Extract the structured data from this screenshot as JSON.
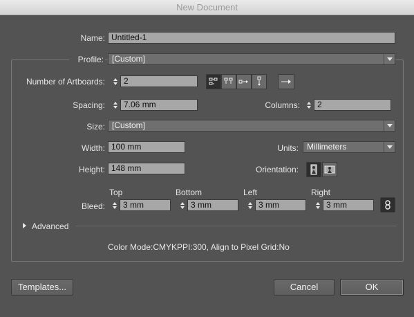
{
  "window": {
    "title": "New Document"
  },
  "name": {
    "label": "Name:",
    "value": "Untitled-1"
  },
  "profile": {
    "label": "Profile:",
    "value": "[Custom]"
  },
  "artboards": {
    "label": "Number of Artboards:",
    "value": "2",
    "layout_icons": [
      "grid-by-row-icon",
      "grid-by-column-icon",
      "arrange-by-row-icon",
      "arrange-by-column-icon"
    ],
    "direction_icon": "right-to-left-icon"
  },
  "spacing": {
    "label": "Spacing:",
    "value": "7.06 mm"
  },
  "columns": {
    "label": "Columns:",
    "value": "2"
  },
  "size": {
    "label": "Size:",
    "value": "[Custom]"
  },
  "width": {
    "label": "Width:",
    "value": "100 mm"
  },
  "units": {
    "label": "Units:",
    "value": "Millimeters"
  },
  "height": {
    "label": "Height:",
    "value": "148 mm"
  },
  "orientation": {
    "label": "Orientation:",
    "selected": "portrait"
  },
  "bleed": {
    "label": "Bleed:",
    "top": {
      "label": "Top",
      "value": "3 mm"
    },
    "bottom": {
      "label": "Bottom",
      "value": "3 mm"
    },
    "left": {
      "label": "Left",
      "value": "3 mm"
    },
    "right": {
      "label": "Right",
      "value": "3 mm"
    },
    "link_icon": "chain-link-icon"
  },
  "advanced": {
    "label": "Advanced"
  },
  "summary": "Color Mode:CMYKPPI:300, Align to Pixel Grid:No",
  "buttons": {
    "templates": "Templates...",
    "cancel": "Cancel",
    "ok": "OK"
  }
}
